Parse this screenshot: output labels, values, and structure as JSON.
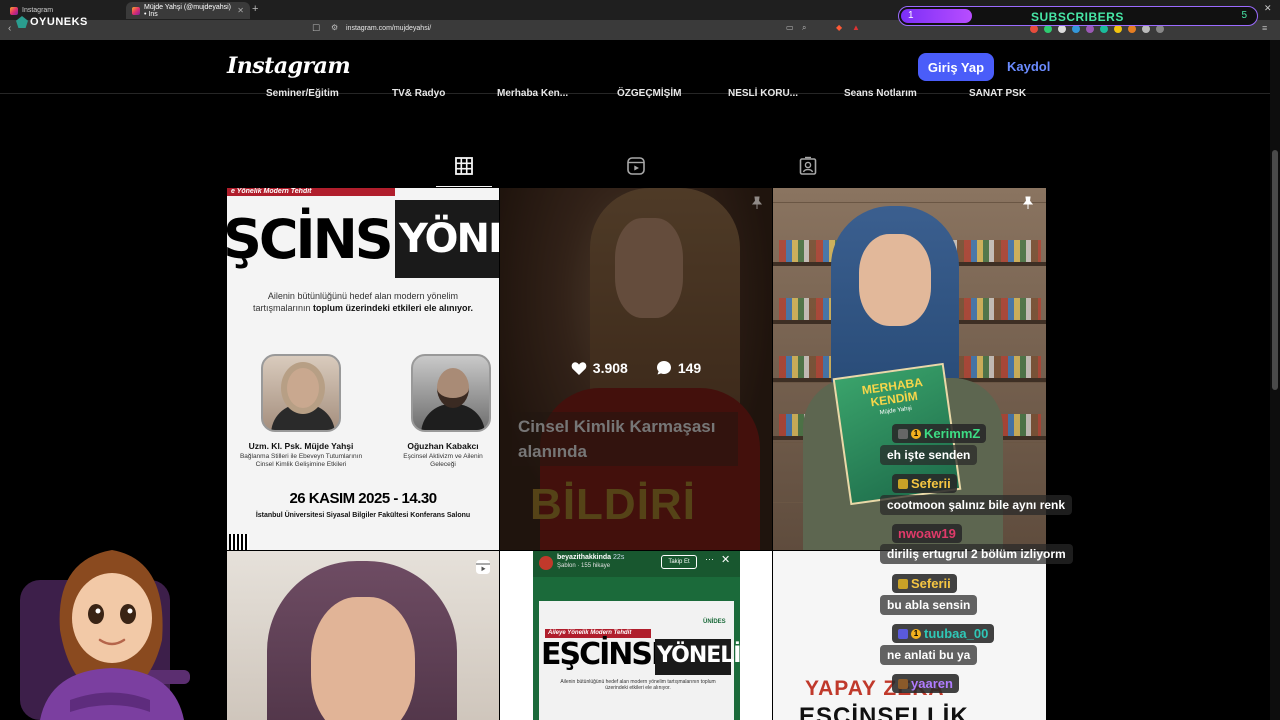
{
  "browser": {
    "tabs": [
      {
        "title": "Instagram"
      },
      {
        "title": "Müjde Yahşi (@mujdeyahsi) • Ins"
      }
    ],
    "url": "instagram.com/mujdeyahsi/"
  },
  "overlay": {
    "brand": "OYUNEKS",
    "subscribers_label": "SUBSCRIBERS",
    "subscribers_current": "1",
    "subscribers_goal": "5",
    "subscribers_progress": 0.2
  },
  "header": {
    "logo": "Instagram",
    "login_label": "Giriş Yap",
    "signup_label": "Kaydol"
  },
  "highlights": [
    "Seminer/Eğitim",
    "TV& Radyo",
    "Merhaba Ken...",
    "ÖZGEÇMİŞİM",
    "NESLİ KORU...",
    "Seans Notlarım",
    "SANAT PSK"
  ],
  "profile_tabs": [
    {
      "name": "posts",
      "icon": "grid-icon"
    },
    {
      "name": "reels",
      "icon": "reels-icon"
    },
    {
      "name": "tagged",
      "icon": "tagged-icon"
    }
  ],
  "posts": {
    "p1": {
      "banner": "e Yönelik Modern Tehdit",
      "title_left": "ŞCİNSEL",
      "title_right": "YÖNELİ",
      "subtitle_a": "Ailenin bütünlüğünü hedef alan modern yönelim tartışmalarının ",
      "subtitle_b": "toplum üzerindeki etkileri ele alınıyor.",
      "speaker1_name": "Uzm. Kl. Psk. Müjde Yahşi",
      "speaker1_topic": "Bağlanma Stilleri ile Ebeveyn Tutumlarının Cinsel Kimlik Gelişimine Etkileri",
      "speaker2_name": "Oğuzhan Kabakcı",
      "speaker2_topic": "Eşcinsel Aktivizm ve Ailenin Geleceği",
      "date": "26 KASIM 2025 - 14.30",
      "venue": "İstanbul Üniversitesi Siyasal Bilgiler Fakültesi Konferans Salonu"
    },
    "p2": {
      "likes": "3.908",
      "comments": "149",
      "caption": "Cinsel Kimlik Karmaşası alanında",
      "word": "BİLDİRİ"
    },
    "p3": {
      "book_title": "MERHABA KENDİM",
      "book_author": "Müjde Yahşi"
    },
    "p5": {
      "user": "beyazithakkinda",
      "time": "22s",
      "meta": "Şablon · 155 hikaye",
      "follow_label": "Takip Et",
      "banner": "Aileye Yönelik Modern Tehdit",
      "title_left": "EŞCİNSEL",
      "title_right": "YÖNELİM",
      "logo": "ÜNİDES",
      "subtitle": "Ailenin bütünlüğünü hedef alan modern yönelim tartışmalarının toplum üzerindeki etkileri ele alınıyor."
    },
    "p6": {
      "line1": "YAPAY ZEKA",
      "line2": "EŞCİNSELLİK"
    }
  },
  "chat": [
    {
      "user": "KerimmZ",
      "color": "#3ddc84",
      "text": "eh işte senden"
    },
    {
      "user": "Seferii",
      "color": "#f5c542",
      "text": "cootmoon şalınız bile aynı renk"
    },
    {
      "user": "nwoaw19",
      "color": "#e03a6a",
      "text": "diriliş ertugrul 2 bölüm izliyorm"
    },
    {
      "user": "Seferii",
      "color": "#f5c542",
      "text": "bu abla sensin"
    },
    {
      "user": "tuubaa_00",
      "color": "#2fc7b7",
      "text": "ne anlati bu ya"
    },
    {
      "user": "yaaren",
      "color": "#b07cff",
      "text": ""
    }
  ]
}
